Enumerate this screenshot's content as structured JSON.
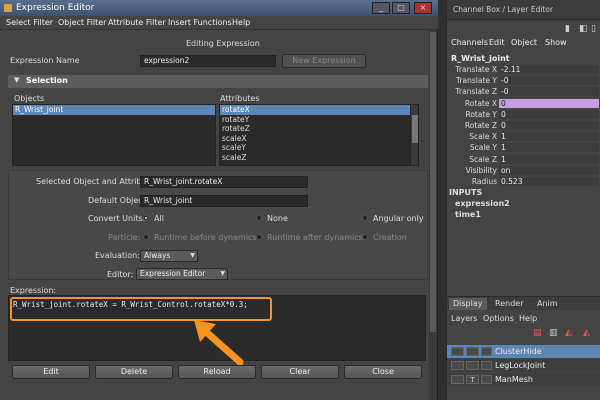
{
  "window": {
    "title": "Expression Editor",
    "min_label": "_",
    "max_label": "□",
    "close_label": "×"
  },
  "menu": [
    "Select Filter",
    "Object Filter",
    "Attribute Filter",
    "Insert Functions",
    "Help"
  ],
  "editing_label": "Editing Expression",
  "expression_name": {
    "label": "Expression Name",
    "value": "expression2"
  },
  "new_expression_button": "New Expression",
  "selection": {
    "header": "Selection",
    "objects_label": "Objects",
    "attributes_label": "Attributes",
    "objects": [
      "R_Wrist_joint"
    ],
    "attributes": [
      "rotateX",
      "rotateY",
      "rotateZ",
      "scaleX",
      "scaleY",
      "scaleZ"
    ]
  },
  "selected_object_attr": {
    "label": "Selected Object and Attribute:",
    "value": "R_Wrist_joint.rotateX"
  },
  "default_object": {
    "label": "Default Object:",
    "value": "R_Wrist_joint"
  },
  "convert_units": {
    "label": "Convert Units:",
    "options": [
      "All",
      "None",
      "Angular only"
    ]
  },
  "particle": {
    "label": "Particle:",
    "options": [
      "Runtime before dynamics",
      "Runtime after dynamics",
      "Creation"
    ]
  },
  "evaluation": {
    "label": "Evaluation:",
    "value": "Always"
  },
  "editor": {
    "label": "Editor:",
    "value": "Expression Editor"
  },
  "expression": {
    "label": "Expression:",
    "text": "R_Wrist_joint.rotateX = R_Wrist_Control.rotateX*0.3;"
  },
  "bottom_buttons": [
    "Edit",
    "Delete",
    "Reload",
    "Clear",
    "Close"
  ],
  "highlight_color": "#f7931e",
  "channel_box": {
    "title": "Channel Box / Layer Editor",
    "menu": [
      "Channels",
      "Edit",
      "Object",
      "Show"
    ],
    "object_name": "R_Wrist_joint",
    "attributes": [
      {
        "name": "Translate X",
        "value": "-2.11"
      },
      {
        "name": "Translate Y",
        "value": "-0"
      },
      {
        "name": "Translate Z",
        "value": "-0"
      },
      {
        "name": "Rotate X",
        "value": "0",
        "highlight": true
      },
      {
        "name": "Rotate Y",
        "value": "0"
      },
      {
        "name": "Rotate Z",
        "value": "0"
      },
      {
        "name": "Scale X",
        "value": "1"
      },
      {
        "name": "Scale Y",
        "value": "1"
      },
      {
        "name": "Scale Z",
        "value": "1"
      },
      {
        "name": "Visibility",
        "value": "on"
      },
      {
        "name": "Radius",
        "value": "0.523"
      }
    ],
    "inputs_header": "INPUTS",
    "inputs": [
      "expression2",
      "time1"
    ],
    "layer_tabs": [
      "Display",
      "Render",
      "Anim"
    ],
    "layer_menu": [
      "Layers",
      "Options",
      "Help"
    ],
    "layers": [
      {
        "name": "ClusterHide",
        "flag": "",
        "selected": true
      },
      {
        "name": "LegLockJoint",
        "flag": "",
        "selected": false
      },
      {
        "name": "ManMesh",
        "flag": "T",
        "selected": false
      }
    ]
  }
}
